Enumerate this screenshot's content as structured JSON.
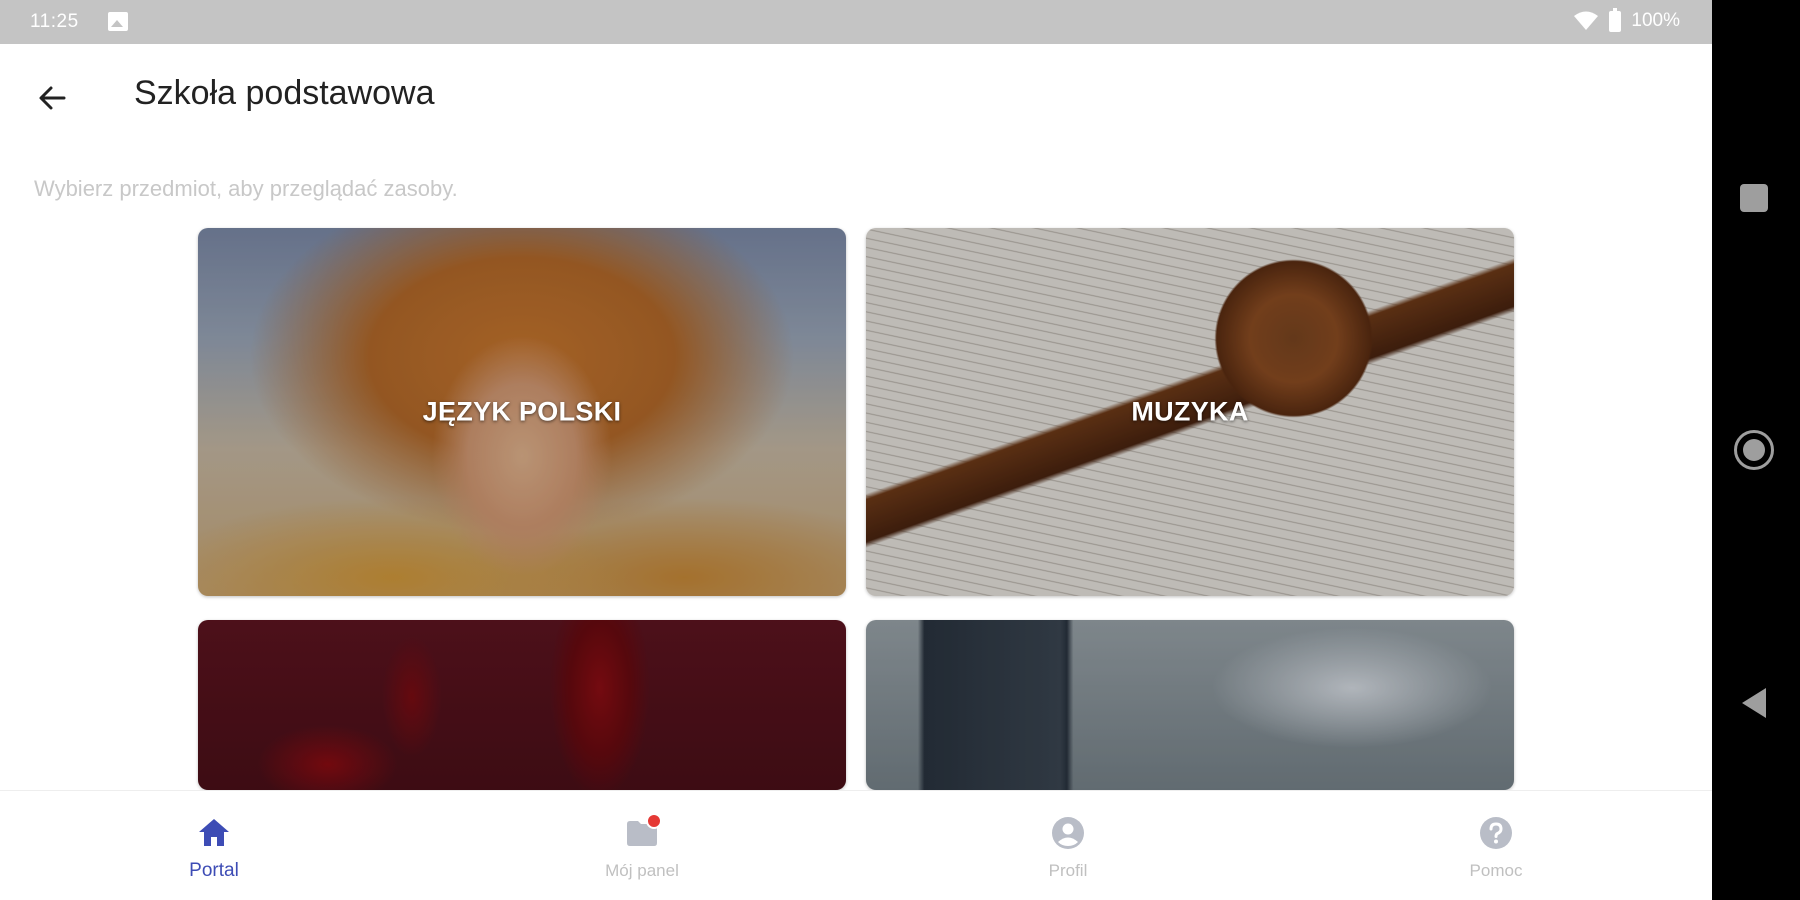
{
  "status_bar": {
    "time": "11:25",
    "battery": "100%"
  },
  "header": {
    "title": "Szkoła podstawowa"
  },
  "subtitle": "Wybierz przedmiot, aby przeglądać zasoby.",
  "subjects": [
    {
      "label": "JĘZYK POLSKI"
    },
    {
      "label": "MUZYKA"
    },
    {
      "label": ""
    },
    {
      "label": ""
    }
  ],
  "bottom_nav": {
    "items": [
      {
        "label": "Portal",
        "icon": "home-icon"
      },
      {
        "label": "Mój panel",
        "icon": "folder-icon"
      },
      {
        "label": "Profil",
        "icon": "account-circle-icon"
      },
      {
        "label": "Pomoc",
        "icon": "help-icon"
      }
    ]
  },
  "colors": {
    "accent": "#3d4cb5",
    "inactive": "#c0c0c0",
    "badge": "#e53935"
  }
}
